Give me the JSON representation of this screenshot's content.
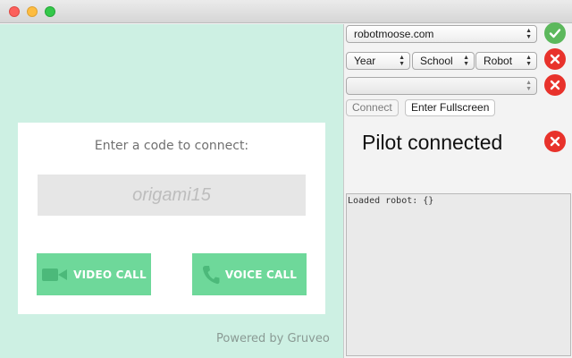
{
  "window": {
    "controls": [
      "close",
      "minimize",
      "maximize"
    ]
  },
  "gruveo": {
    "prompt": "Enter a code to connect:",
    "code_value": "origami15",
    "video_call_label": "VIDEO CALL",
    "voice_call_label": "VOICE CALL",
    "powered_by": "Powered by Gruveo",
    "colors": {
      "panel_bg": "#cdf0e3",
      "button_bg": "#6ed89a",
      "video_icon": "#4cb97a"
    },
    "icons": {
      "video": "video-camera-icon",
      "voice": "phone-icon"
    }
  },
  "controls": {
    "server_select": {
      "value": "robotmoose.com",
      "status": "ok"
    },
    "robot_selectors": {
      "year": "Year",
      "school": "School",
      "robot": "Robot",
      "status": "error"
    },
    "blank_select": {
      "value": "",
      "status": "error"
    },
    "connect_button": "Connect",
    "fullscreen_button": "Enter Fullscreen",
    "pilot_status_text": "Pilot connected",
    "pilot_status": "error",
    "log_text": "Loaded robot: {}",
    "colors": {
      "ok": "#5cb85c",
      "error": "#e8322b"
    },
    "icons": {
      "ok": "check-icon",
      "error": "x-icon"
    }
  }
}
